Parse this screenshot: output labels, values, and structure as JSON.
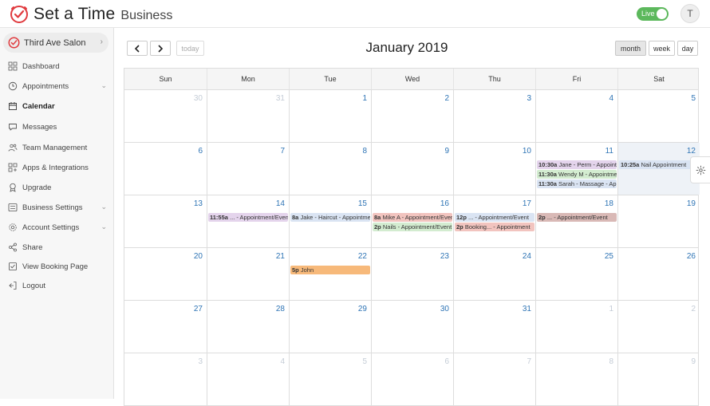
{
  "app": {
    "brand": "Set a Time",
    "brand_suffix": "Business",
    "live_label": "Live",
    "avatar_initial": "T"
  },
  "sidebar": {
    "business_name": "Third Ave Salon",
    "items": [
      {
        "label": "Dashboard",
        "icon": "dashboard-icon"
      },
      {
        "label": "Appointments",
        "icon": "clock-icon",
        "expandable": true
      },
      {
        "label": "Calendar",
        "icon": "calendar-icon",
        "active": true
      },
      {
        "label": "Messages",
        "icon": "chat-icon"
      },
      {
        "label": "Team Management",
        "icon": "team-icon"
      },
      {
        "label": "Apps & Integrations",
        "icon": "apps-icon"
      },
      {
        "label": "Upgrade",
        "icon": "badge-icon"
      },
      {
        "label": "Business Settings",
        "icon": "settings-icon",
        "expandable": true
      },
      {
        "label": "Account Settings",
        "icon": "gear-icon",
        "expandable": true
      },
      {
        "label": "Share",
        "icon": "share-icon"
      },
      {
        "label": "View Booking Page",
        "icon": "checkbox-icon"
      },
      {
        "label": "Logout",
        "icon": "logout-icon"
      }
    ]
  },
  "toolbar": {
    "prev": "‹",
    "next": "›",
    "today": "today",
    "month": "month",
    "week": "week",
    "day": "day"
  },
  "calendar": {
    "title": "January 2019",
    "weekdays": [
      "Sun",
      "Mon",
      "Tue",
      "Wed",
      "Thu",
      "Fri",
      "Sat"
    ],
    "weeks": [
      [
        "30",
        "31",
        "1",
        "2",
        "3",
        "4",
        "5"
      ],
      [
        "6",
        "7",
        "8",
        "9",
        "10",
        "11",
        "12"
      ],
      [
        "13",
        "14",
        "15",
        "16",
        "17",
        "18",
        "19"
      ],
      [
        "20",
        "21",
        "22",
        "23",
        "24",
        "25",
        "26"
      ],
      [
        "27",
        "28",
        "29",
        "30",
        "31",
        "1",
        "2"
      ],
      [
        "3",
        "4",
        "5",
        "6",
        "7",
        "8",
        "9"
      ]
    ],
    "events": [
      {
        "time": "10:30a",
        "title": "Jane - Perm - Appointment",
        "week": 1,
        "day": 5,
        "slot": 0,
        "color": "#e4d4ec"
      },
      {
        "time": "11:30a",
        "title": "Wendy M - Appointment",
        "week": 1,
        "day": 5,
        "slot": 1,
        "color": "#d3ecd0"
      },
      {
        "time": "11:30a",
        "title": "Sarah - Massage - Appointment",
        "week": 1,
        "day": 5,
        "slot": 2,
        "color": "#dae4f3"
      },
      {
        "time": "10:25a",
        "title": "Nail Appointment",
        "week": 1,
        "day": 6,
        "slot": 0,
        "color": "#dae4f3"
      },
      {
        "time": "11:55a",
        "title": "... - Appointment/Event",
        "week": 2,
        "day": 1,
        "slot": 0,
        "color": "#e4d4ec"
      },
      {
        "time": "8a",
        "title": "Jake - Haircut - Appointment",
        "week": 2,
        "day": 2,
        "slot": 0,
        "color": "#dae4f3"
      },
      {
        "time": "8a",
        "title": "Mike A - Appointment/Event",
        "week": 2,
        "day": 3,
        "slot": 0,
        "color": "#f2c4bf"
      },
      {
        "time": "2p",
        "title": "Nails - Appointment/Event",
        "week": 2,
        "day": 3,
        "slot": 1,
        "color": "#d3ecd0"
      },
      {
        "time": "12p",
        "title": "... - Appointment/Event",
        "week": 2,
        "day": 4,
        "slot": 0,
        "color": "#dae4f3"
      },
      {
        "time": "2p",
        "title": "Booking... - Appointment",
        "week": 2,
        "day": 4,
        "slot": 1,
        "color": "#f2c4bf"
      },
      {
        "time": "2p",
        "title": "... - Appointment/Event",
        "week": 2,
        "day": 5,
        "slot": 0,
        "color": "#d9b9b6"
      },
      {
        "time": "5p",
        "title": "John",
        "week": 3,
        "day": 2,
        "slot": 0,
        "color": "#f7b97a"
      }
    ]
  }
}
